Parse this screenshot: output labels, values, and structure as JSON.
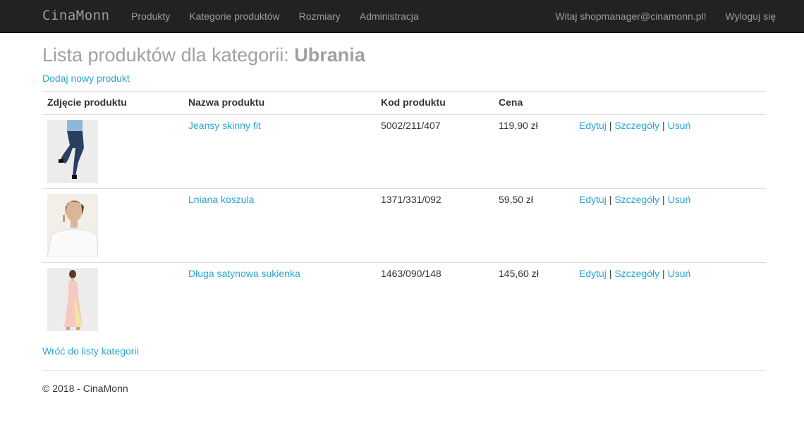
{
  "nav": {
    "brand": "CinaMonn",
    "items": [
      "Produkty",
      "Kategorie produktów",
      "Rozmiary",
      "Administracja"
    ],
    "greeting": "Witaj shopmanager@cinamonn.pl!",
    "logout": "Wyloguj się"
  },
  "page": {
    "title_prefix": "Lista produktów dla kategorii: ",
    "title_category": "Ubrania",
    "add_link": "Dodaj nowy produkt",
    "back_link": "Wróć do listy kategorii",
    "footer": "© 2018 - CinaMonn"
  },
  "table": {
    "headers": [
      "Zdjęcie produktu",
      "Nazwa produktu",
      "Kod produktu",
      "Cena"
    ],
    "actions": {
      "edit": "Edytuj",
      "details": "Szczegóły",
      "delete": "Usuń",
      "separator": "|"
    },
    "rows": [
      {
        "name": "Jeansy skinny fit",
        "code": "5002/211/407",
        "price": "119,90 zł",
        "photo": "jeans-photo"
      },
      {
        "name": "Lniana koszula",
        "code": "1371/331/092",
        "price": "59,50 zł",
        "photo": "shirt-photo"
      },
      {
        "name": "Długa satynowa sukienka",
        "code": "1463/090/148",
        "price": "145,60 zł",
        "photo": "dress-photo"
      }
    ]
  }
}
